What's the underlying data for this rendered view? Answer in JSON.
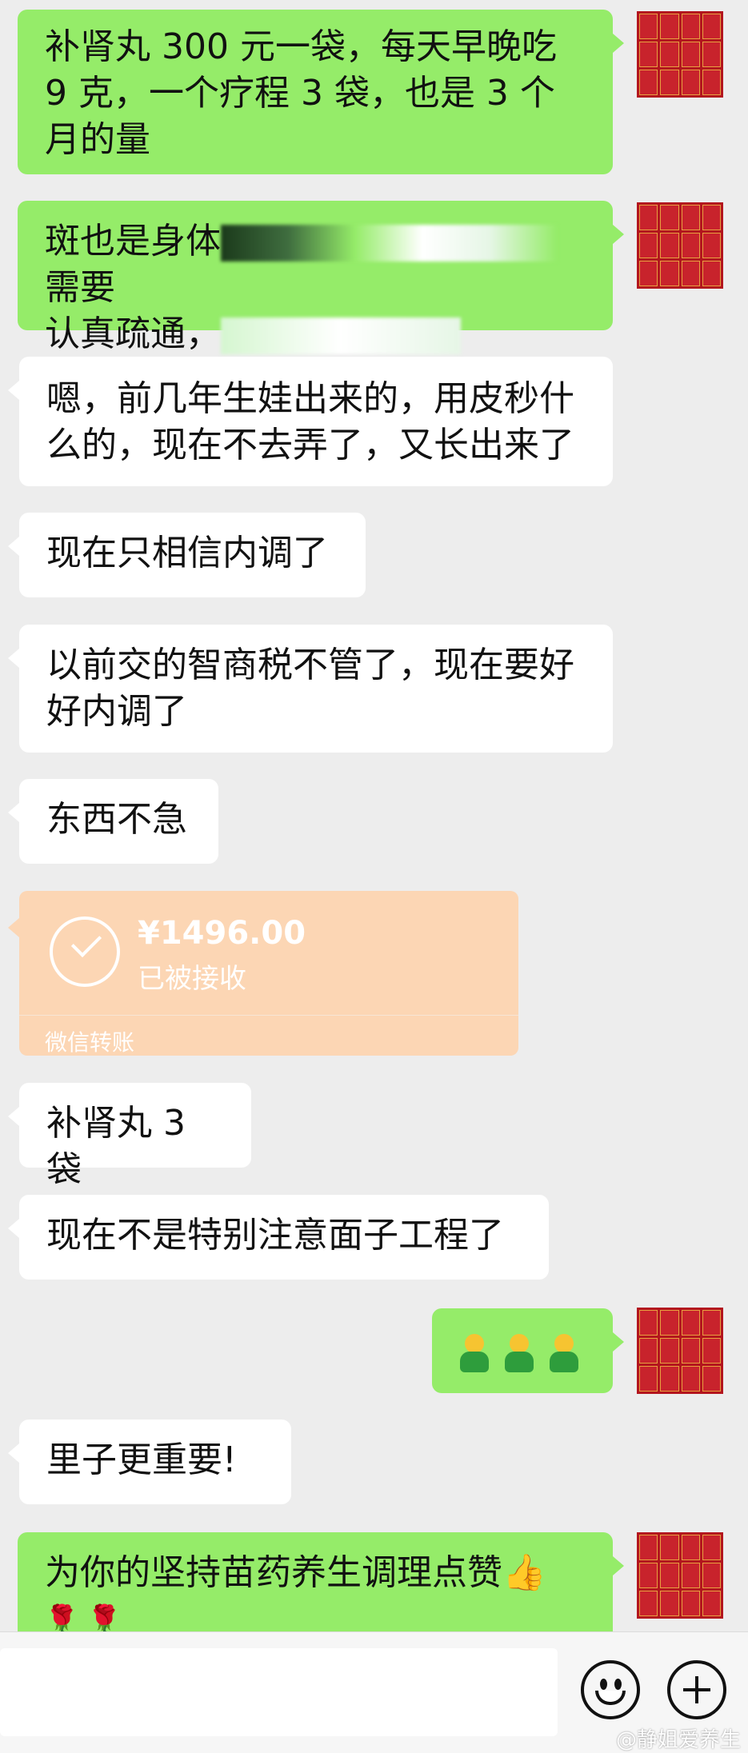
{
  "messages": [
    {
      "text_a": "补肾丸 300 元一袋，每天早晚吃 9 克，一个疗程 3 袋，也是 3 个月的量"
    },
    {
      "line1_a": "斑也是身体",
      "line1_b": "需要",
      "line2_a": "认真疏通，"
    },
    {
      "text_a": "嗯，前几年生娃出来的，用皮秒什么的，现在不去弄了，又长出来了"
    },
    {
      "text_a": "现在只相信内调了"
    },
    {
      "text_a": "以前交的智商税不管了，现在要好好内调了"
    },
    {
      "text_a": "东西不急"
    },
    {
      "text_a": "补肾丸 3 袋"
    },
    {
      "text_a": "现在不是特别注意面子工程了"
    },
    {
      "text_a": "里子更重要!"
    },
    {
      "text_a": "为你的坚持苗药养生调理点赞👍",
      "text_b": "🌹 🌹"
    }
  ],
  "transfer": {
    "amount": "¥1496.00",
    "status": "已被接收",
    "label": "微信转账"
  },
  "watermark": "@静姐爱养生",
  "icons": {
    "emoji": "smile-icon",
    "more": "plus-icon"
  }
}
